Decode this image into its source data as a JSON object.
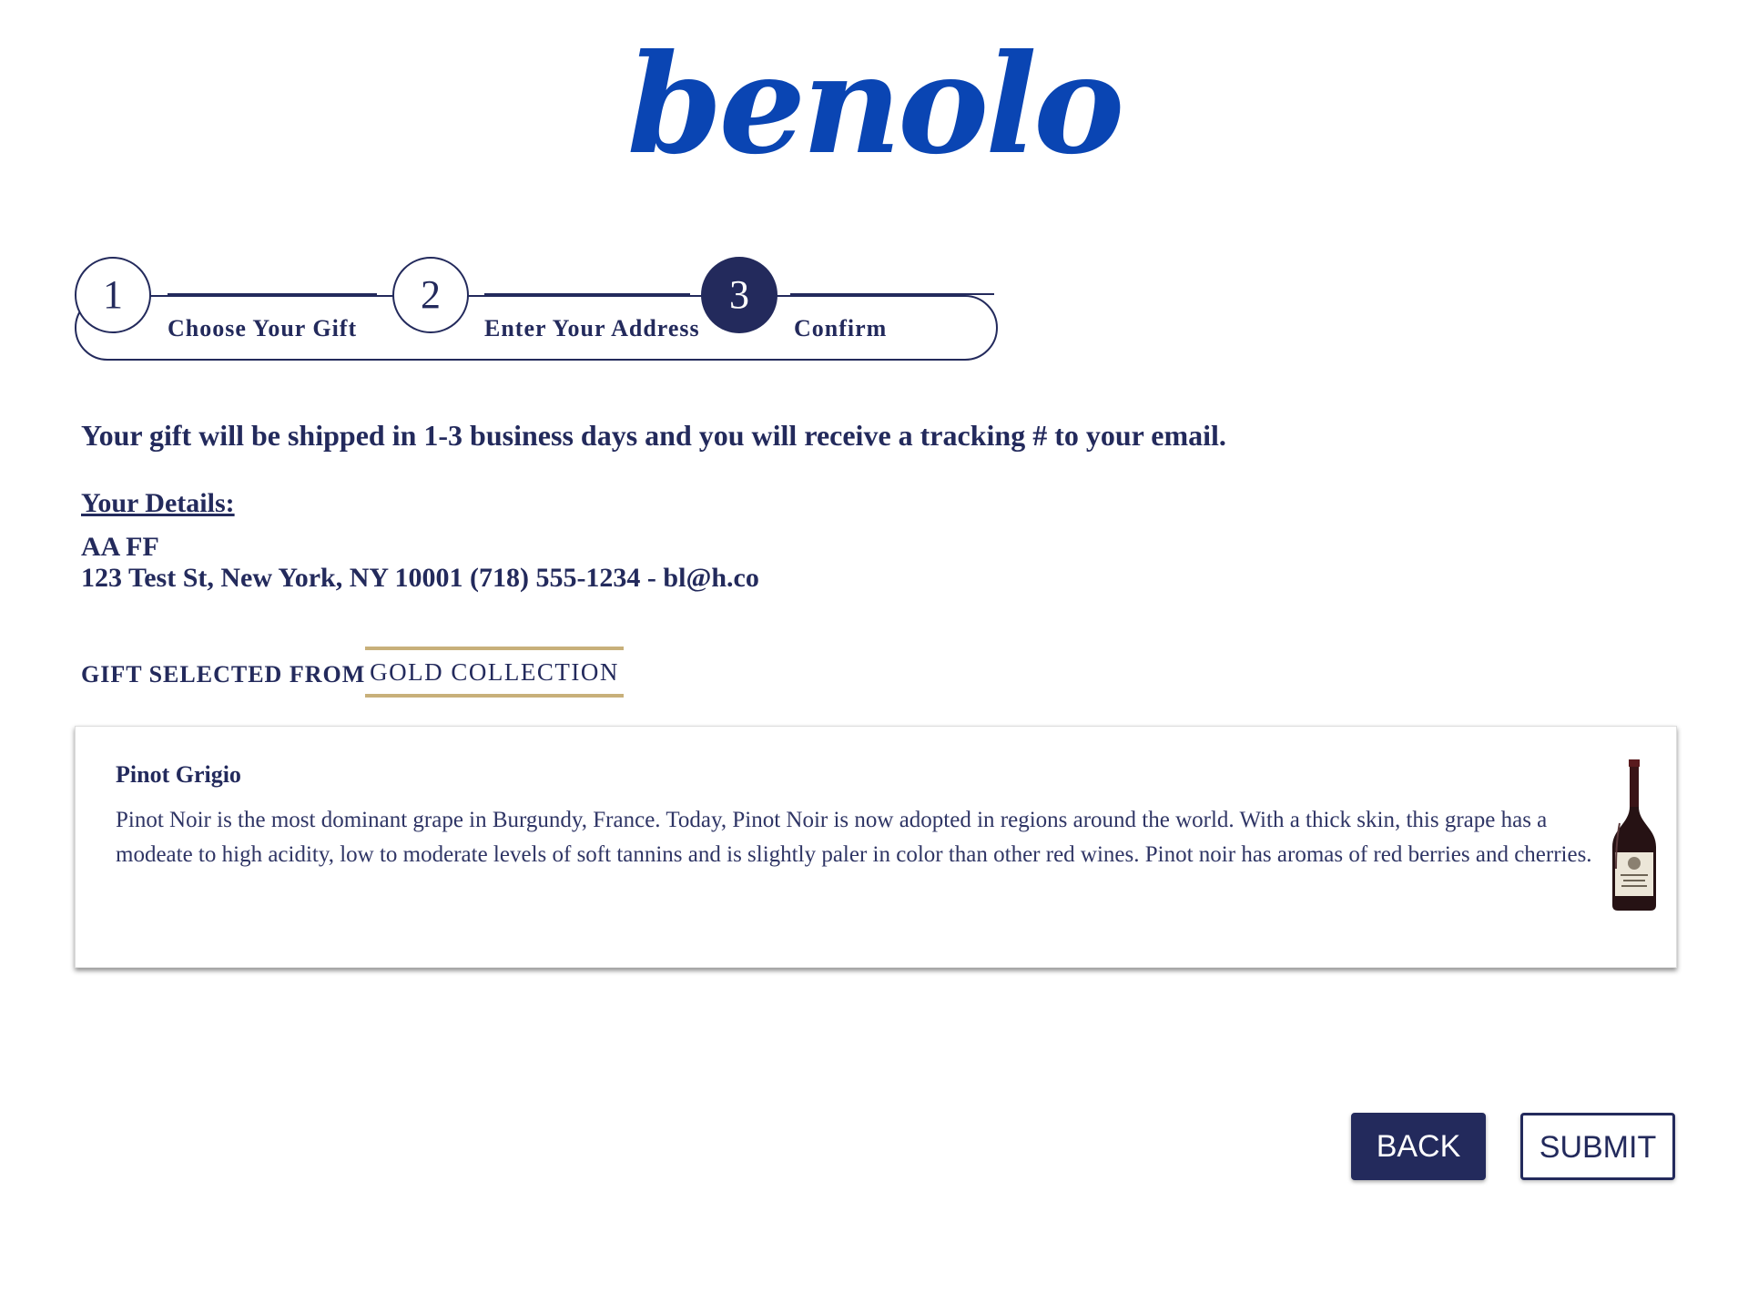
{
  "logo": {
    "text": "benolo"
  },
  "stepper": {
    "steps": [
      {
        "number": "1",
        "label": "Choose Your Gift"
      },
      {
        "number": "2",
        "label": "Enter Your Address"
      },
      {
        "number": "3",
        "label": "Confirm"
      }
    ],
    "active_step": 3
  },
  "message": "Your gift will be shipped in 1-3 business days and you will receive a tracking # to your email.",
  "details": {
    "title": "Your Details:",
    "name": "AA FF",
    "line": "123 Test St, New York, NY 10001 (718) 555-1234 - bl@h.co"
  },
  "gift": {
    "selected_from_label": "GIFT SELECTED FROM",
    "collection": "GOLD COLLECTION",
    "item": {
      "name": "Pinot Grigio",
      "description": "Pinot Noir is the most dominant grape in Burgundy, France. Today, Pinot Noir is now adopted in regions around the world. With a thick skin, this grape has a modeate to high acidity, low to moderate levels of soft tannins and is slightly paler in color than other red wines. Pinot noir has aromas of red berries and cherries.",
      "image_icon": "wine-bottle"
    }
  },
  "buttons": {
    "back": "BACK",
    "submit": "SUBMIT"
  },
  "colors": {
    "navy": "#232a5c",
    "brand_blue": "#0a45b3",
    "gold": "#c8b07a"
  }
}
